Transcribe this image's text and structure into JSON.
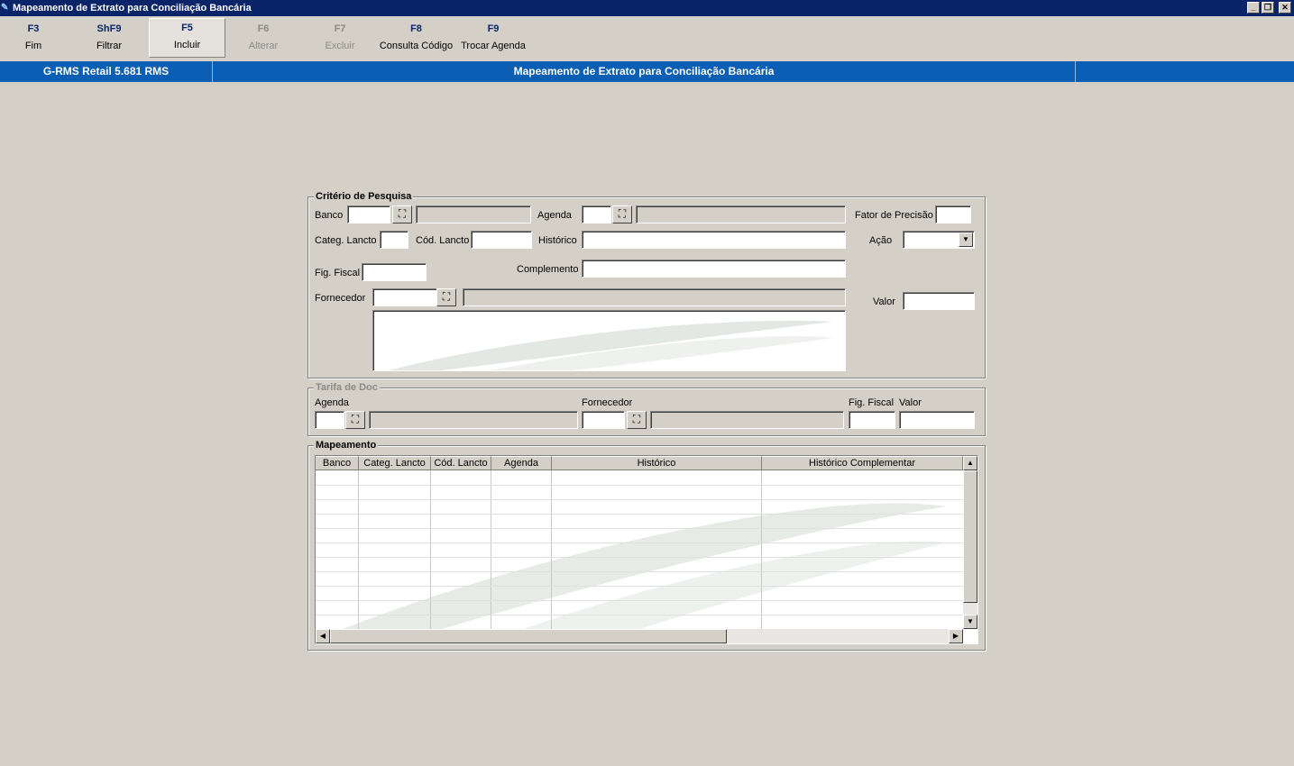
{
  "window": {
    "title": "Mapeamento de Extrato para Conciliação Bancária",
    "min_glyph": "_",
    "restore_glyph": "❐",
    "close_glyph": "✕"
  },
  "toolbar": {
    "f3_key": "F3",
    "f3_label": "Fim",
    "shf9_key": "ShF9",
    "shf9_label": "Filtrar",
    "f5_key": "F5",
    "f5_label": "Incluir",
    "f6_key": "F6",
    "f6_label": "Alterar",
    "f7_key": "F7",
    "f7_label": "Excluir",
    "f8_key": "F8",
    "f8_label": "Consulta Código",
    "f9_key": "F9",
    "f9_label": "Trocar Agenda"
  },
  "header": {
    "app_version": "G-RMS Retail 5.681 RMS",
    "screen_title": "Mapeamento de Extrato para Conciliação Bancária"
  },
  "criteria": {
    "legend": "Critério de Pesquisa",
    "banco_label": "Banco",
    "agenda_label": "Agenda",
    "fator_label": "Fator de Precisão",
    "categ_label": "Categ. Lancto",
    "cod_label": "Cód. Lancto",
    "historico_label": "Histórico",
    "acao_label": "Ação",
    "figfiscal_label": "Fig. Fiscal",
    "complemento_label": "Complemento",
    "fornecedor_label": "Fornecedor",
    "valor_label": "Valor"
  },
  "tarifa": {
    "legend": "Tarifa de Doc",
    "agenda_label": "Agenda",
    "fornecedor_label": "Fornecedor",
    "figfiscal_label": "Fig. Fiscal",
    "valor_label": "Valor"
  },
  "mapeamento": {
    "legend": "Mapeamento",
    "columns": [
      "Banco",
      "Categ. Lancto",
      "Cód. Lancto",
      "Agenda",
      "Histórico",
      "Histórico Complementar"
    ]
  },
  "icons": {
    "binoculars": "binoculars-icon",
    "dropdown": "chevron-down-icon"
  }
}
